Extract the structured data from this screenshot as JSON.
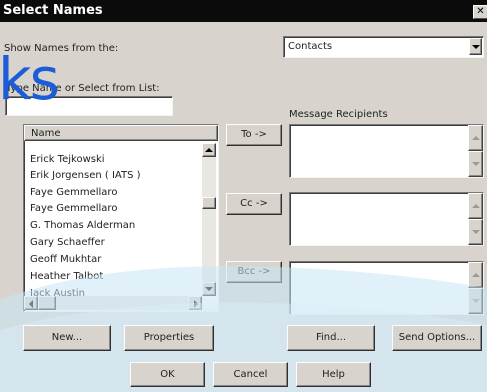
{
  "dialog": {
    "title": "Select Names",
    "close_glyph": "✕"
  },
  "show_names": {
    "label": "Show Names from the:",
    "selected": "Contacts"
  },
  "search": {
    "label": "Type Name or Select from List:",
    "value": ""
  },
  "watermark_text": "ks",
  "names_list": {
    "header": "Name",
    "items": [
      "Erick Tejkowski",
      "Erik Jorgensen ( IATS )",
      "Faye Gemmellaro",
      "Faye Gemmellaro",
      "G. Thomas Alderman",
      "Gary Schaeffer",
      "Geoff Mukhtar",
      "Heather Talbot",
      "Jack Austin"
    ]
  },
  "recipients": {
    "label": "Message Recipients",
    "to_button": "To ->",
    "cc_button": "Cc ->",
    "bcc_button": "Bcc ->"
  },
  "bottom_buttons": {
    "new": "New...",
    "properties": "Properties",
    "find": "Find...",
    "send_options": "Send Options...",
    "ok": "OK",
    "cancel": "Cancel",
    "help": "Help"
  },
  "colors": {
    "dialog_bg": "#d8d4cd",
    "titlebar": "#0b0b0b",
    "watermark": "#1b5cd8",
    "wave_overlay": "#c9e6f5"
  },
  "icons": {
    "dropdown": "chevron-down-icon",
    "scroll_up": "arrow-up-icon",
    "scroll_down": "arrow-down-icon",
    "scroll_left": "arrow-left-icon",
    "scroll_right": "arrow-right-icon",
    "close": "close-icon"
  }
}
